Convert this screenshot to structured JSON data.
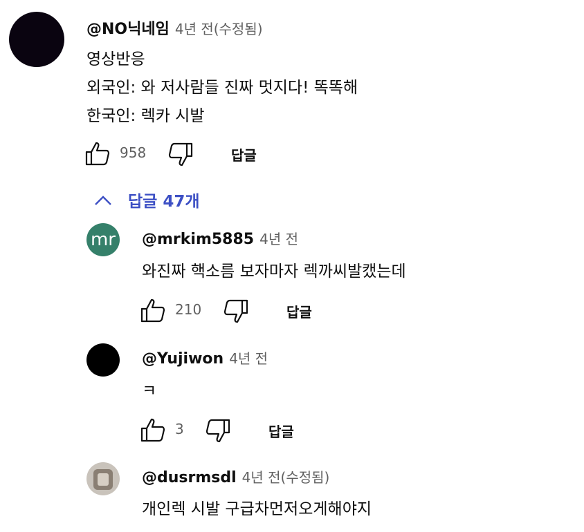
{
  "comment": {
    "handle": "@NO닉네임",
    "time": "4년 전(수정됨)",
    "lines": [
      "영상반응",
      "외국인: 와 저사람들 진짜 멋지다! 똑똑해",
      "한국인: 렉카 시발"
    ],
    "likes": "958",
    "reply_label": "답글"
  },
  "replies_toggle": {
    "label": "답글 47개",
    "icon": "chevron-up-icon"
  },
  "replies": [
    {
      "avatar_text": "mr",
      "avatar_color": "#35806a",
      "handle": "@mrkim5885",
      "time": "4년 전",
      "text": "와진짜 핵소름 보자마자 렉까씨발캤는데",
      "likes": "210",
      "reply_label": "답글"
    },
    {
      "handle": "@Yujiwon",
      "time": "4년 전",
      "text": "ㅋ",
      "likes": "3",
      "reply_label": "답글"
    },
    {
      "handle": "@dusrmsdl",
      "time": "4년 전(수정됨)",
      "text": "개인렉 시발 구급차먼저오게해야지"
    }
  ],
  "colors": {
    "link_blue": "#3c4fc4",
    "secondary_text": "#606060"
  }
}
